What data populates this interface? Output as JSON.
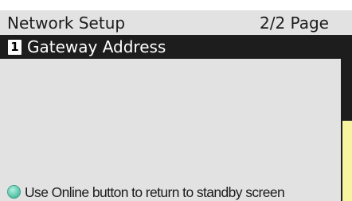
{
  "header": {
    "title": "Network Setup",
    "page_indicator": "2/2 Page"
  },
  "menu": {
    "items": [
      {
        "number": "1",
        "label": "Gateway Address",
        "selected": true
      }
    ]
  },
  "scrollbar": {
    "position_fraction": 0.5
  },
  "footer": {
    "hint_icon": "online-button-icon",
    "hint_text": "Use Online button to return to standby screen"
  },
  "colors": {
    "screen_background": "#e2e2e2",
    "selection_background": "#1d1d1d",
    "scroll_thumb": "#f7f3a1",
    "online_icon": "#5bc8ac"
  }
}
